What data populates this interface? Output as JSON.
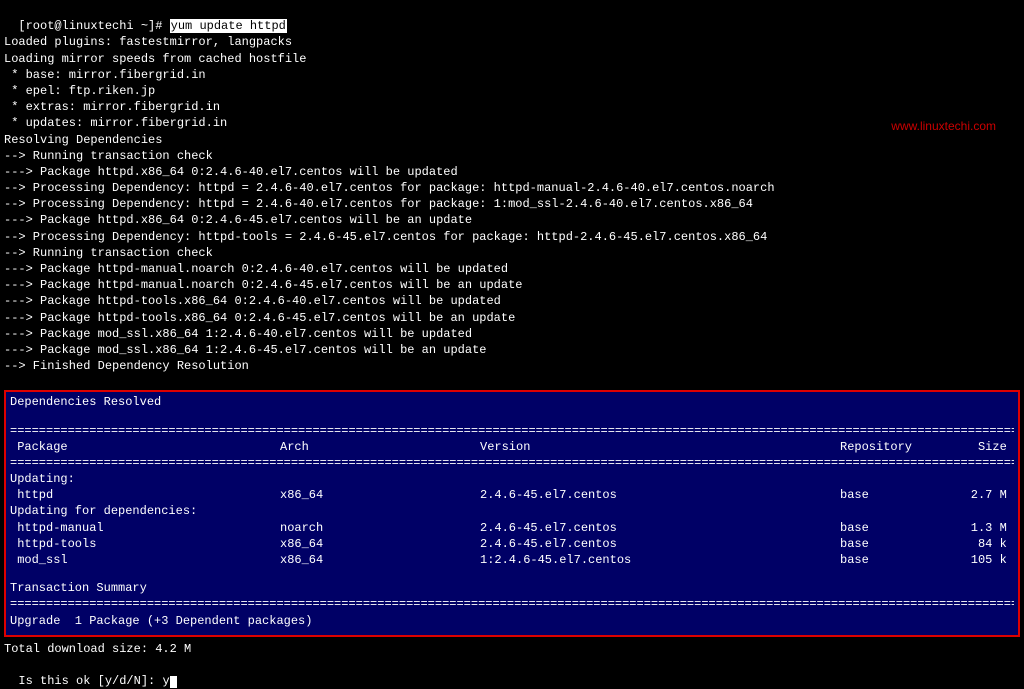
{
  "prompt": {
    "prefix": "[root@linuxtechi ~]# ",
    "command": "yum update httpd"
  },
  "watermark": "www.linuxtechi.com",
  "pre_output": [
    "Loaded plugins: fastestmirror, langpacks",
    "Loading mirror speeds from cached hostfile",
    " * base: mirror.fibergrid.in",
    " * epel: ftp.riken.jp",
    " * extras: mirror.fibergrid.in",
    " * updates: mirror.fibergrid.in",
    "Resolving Dependencies",
    "--> Running transaction check",
    "---> Package httpd.x86_64 0:2.4.6-40.el7.centos will be updated",
    "--> Processing Dependency: httpd = 2.4.6-40.el7.centos for package: httpd-manual-2.4.6-40.el7.centos.noarch",
    "--> Processing Dependency: httpd = 2.4.6-40.el7.centos for package: 1:mod_ssl-2.4.6-40.el7.centos.x86_64",
    "---> Package httpd.x86_64 0:2.4.6-45.el7.centos will be an update",
    "--> Processing Dependency: httpd-tools = 2.4.6-45.el7.centos for package: httpd-2.4.6-45.el7.centos.x86_64",
    "--> Running transaction check",
    "---> Package httpd-manual.noarch 0:2.4.6-40.el7.centos will be updated",
    "---> Package httpd-manual.noarch 0:2.4.6-45.el7.centos will be an update",
    "---> Package httpd-tools.x86_64 0:2.4.6-40.el7.centos will be updated",
    "---> Package httpd-tools.x86_64 0:2.4.6-45.el7.centos will be an update",
    "---> Package mod_ssl.x86_64 1:2.4.6-40.el7.centos will be updated",
    "---> Package mod_ssl.x86_64 1:2.4.6-45.el7.centos will be an update",
    "--> Finished Dependency Resolution"
  ],
  "deps_box": {
    "title": "Dependencies Resolved",
    "rule": "==========================================================================================================================================================================",
    "headers": {
      "pkg": " Package",
      "arch": "Arch",
      "ver": "Version",
      "repo": "Repository",
      "size": "Size "
    },
    "updating_label": "Updating:",
    "updating_dep_label": "Updating for dependencies:",
    "rows_primary": [
      {
        "pkg": " httpd",
        "arch": "x86_64",
        "ver": "2.4.6-45.el7.centos",
        "repo": "base",
        "size": "2.7 M "
      }
    ],
    "rows_deps": [
      {
        "pkg": " httpd-manual",
        "arch": "noarch",
        "ver": "2.4.6-45.el7.centos",
        "repo": "base",
        "size": "1.3 M "
      },
      {
        "pkg": " httpd-tools",
        "arch": "x86_64",
        "ver": "2.4.6-45.el7.centos",
        "repo": "base",
        "size": "84 k "
      },
      {
        "pkg": " mod_ssl",
        "arch": "x86_64",
        "ver": "1:2.4.6-45.el7.centos",
        "repo": "base",
        "size": "105 k "
      }
    ],
    "summary_title": "Transaction Summary",
    "summary_line": "Upgrade  1 Package (+3 Dependent packages)"
  },
  "post_output": {
    "download_size": "Total download size: 4.2 M",
    "confirm_prompt": "Is this ok [y/d/N]: ",
    "confirm_input": "y"
  }
}
